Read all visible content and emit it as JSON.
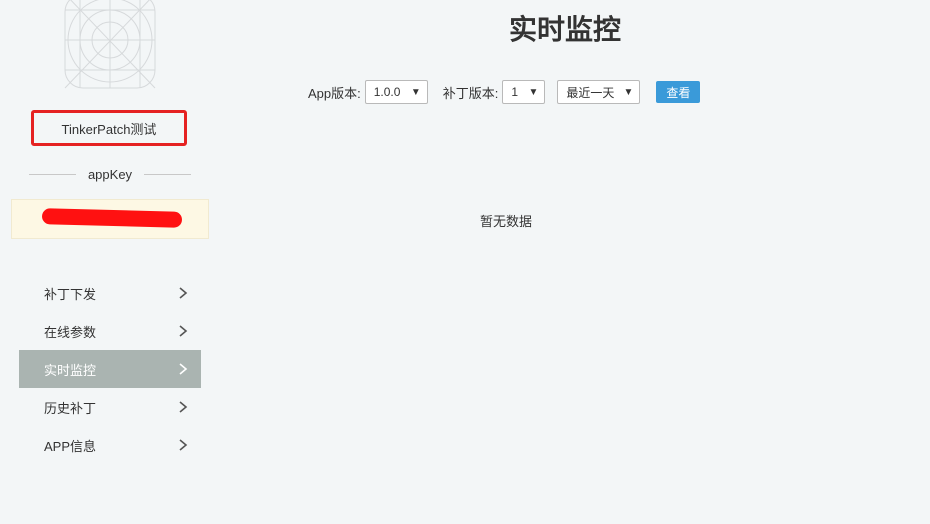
{
  "sidebar": {
    "app_name": "TinkerPatch测试",
    "appkey_label": "appKey",
    "appkey_value": "••••••••••••••2b0e",
    "nav": [
      {
        "label": "补丁下发",
        "active": false
      },
      {
        "label": "在线参数",
        "active": false
      },
      {
        "label": "实时监控",
        "active": true
      },
      {
        "label": "历史补丁",
        "active": false
      },
      {
        "label": "APP信息",
        "active": false
      }
    ]
  },
  "main": {
    "title": "实时监控",
    "filters": {
      "app_version_label": "App版本:",
      "app_version_value": "1.0.0",
      "patch_version_label": "补丁版本:",
      "patch_version_value": "1",
      "range_value": "最近一天",
      "query_label": "查看"
    },
    "empty_text": "暂无数据"
  },
  "colors": {
    "active_nav": "#aab4b1",
    "accent": "#3a9ad9",
    "highlight": "#e52222",
    "appkey_bg": "#fdf8e4"
  }
}
